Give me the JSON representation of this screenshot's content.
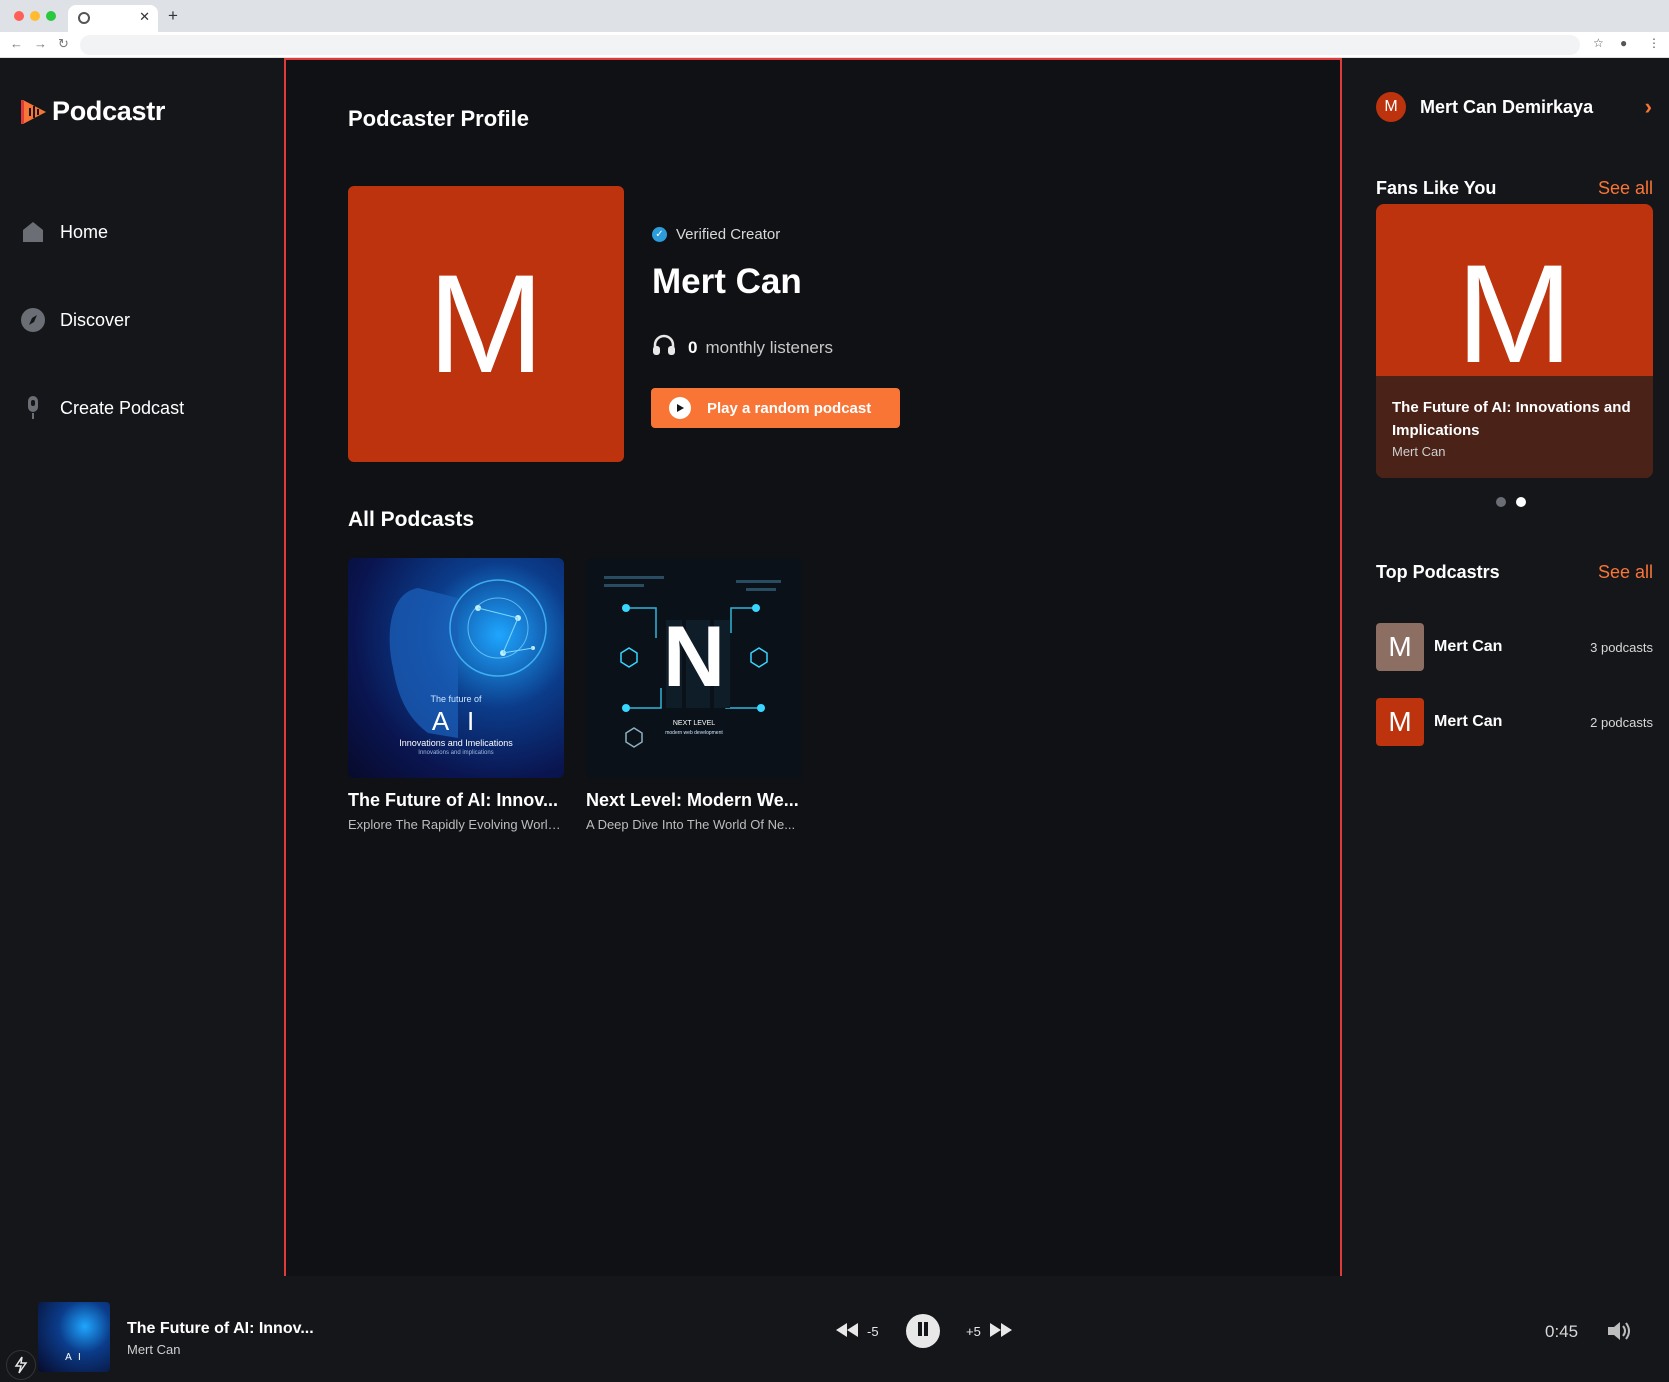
{
  "app": {
    "name": "Podcastr",
    "colors": {
      "accent": "#f97535",
      "brand": "#bc330e",
      "background": "#101114",
      "sidebar": "#15161a"
    }
  },
  "sidebar": {
    "items": [
      {
        "label": "Home",
        "icon": "home-icon"
      },
      {
        "label": "Discover",
        "icon": "compass-icon"
      },
      {
        "label": "Create Podcast",
        "icon": "microphone-icon"
      }
    ]
  },
  "main": {
    "title": "Podcaster Profile",
    "profile": {
      "avatar_letter": "M",
      "verified_label": "Verified Creator",
      "name": "Mert Can",
      "listeners_count": "0",
      "listeners_label": "monthly listeners",
      "play_button": "Play a random podcast"
    },
    "all_podcasts_title": "All Podcasts",
    "podcasts": [
      {
        "title": "The Future of AI: Innov...",
        "description": "Explore The Rapidly Evolving World...",
        "cover": {
          "line1": "The future of",
          "big": "A I",
          "line2": "Innovations and Imelications",
          "line3": "Innovations and implications"
        }
      },
      {
        "title": "Next Level: Modern We...",
        "description": "A Deep Dive Into The World Of Ne...",
        "cover": {
          "big": "N",
          "line1": "NEXT LEVEL",
          "line2": "modern web development"
        }
      }
    ]
  },
  "rightbar": {
    "user": {
      "name": "Mert Can Demirkaya",
      "initial": "M"
    },
    "fans": {
      "title": "Fans Like You",
      "see_all": "See all",
      "card": {
        "letter": "M",
        "title": "The Future of AI: Innovations and Implications",
        "author": "Mert Can"
      },
      "carousel_active_index": 1,
      "carousel_count": 2
    },
    "top": {
      "title": "Top Podcastrs",
      "see_all": "See all",
      "items": [
        {
          "initial": "M",
          "name": "Mert Can",
          "count": "3 podcasts",
          "color": "#8d6e63"
        },
        {
          "initial": "M",
          "name": "Mert Can",
          "count": "2 podcasts",
          "color": "#bc330e"
        }
      ]
    }
  },
  "player": {
    "title": "The Future of AI: Innov...",
    "author": "Mert Can",
    "rewind_label": "-5",
    "forward_label": "+5",
    "time": "0:45",
    "cover_text": "A I"
  }
}
